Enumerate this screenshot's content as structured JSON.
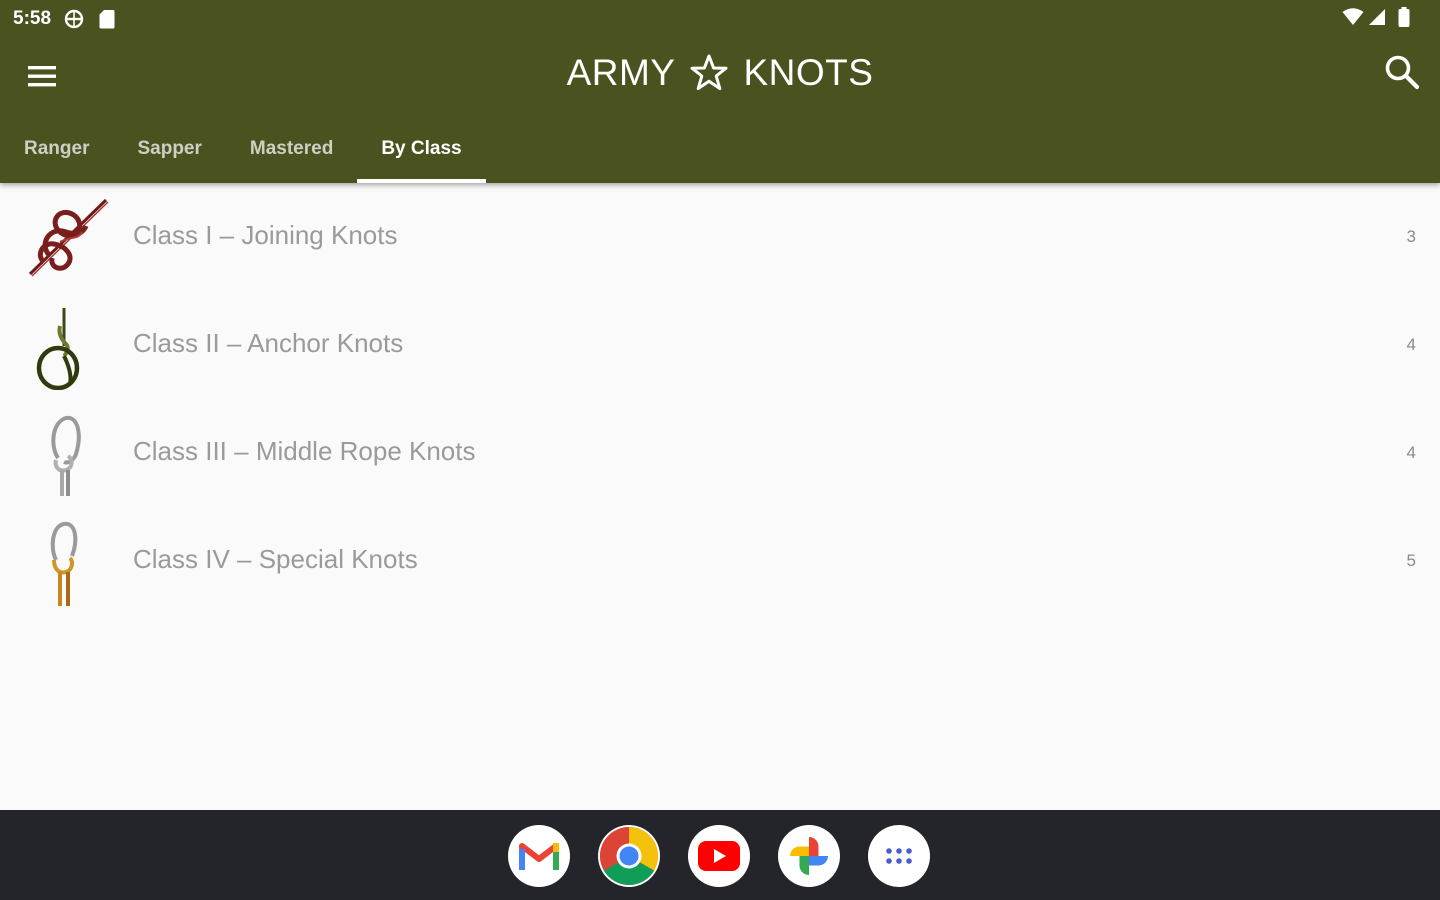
{
  "status_bar": {
    "time": "5:58",
    "icons": [
      "vpn-globe-icon",
      "sd-card-icon",
      "wifi-icon",
      "cell-signal-icon",
      "battery-icon"
    ]
  },
  "toolbar": {
    "title_left": "ARMY",
    "title_right": "KNOTS",
    "title_icon": "star-outline-icon",
    "menu_icon": "hamburger-menu-icon",
    "search_icon": "search-icon"
  },
  "tabs": [
    {
      "label": "Ranger",
      "active": false
    },
    {
      "label": "Sapper",
      "active": false
    },
    {
      "label": "Mastered",
      "active": false
    },
    {
      "label": "By Class",
      "active": true
    }
  ],
  "classes": [
    {
      "label": "Class I – Joining Knots",
      "count": "3",
      "icon": "figure-eight-knot-icon",
      "color": "#7a1d1d"
    },
    {
      "label": "Class II – Anchor Knots",
      "count": "4",
      "icon": "noose-knot-icon",
      "color": "#3b4a12"
    },
    {
      "label": "Class III – Middle Rope Knots",
      "count": "4",
      "icon": "carabiner-gray-knot-icon",
      "color": "#8a8a8a"
    },
    {
      "label": "Class IV – Special Knots",
      "count": "5",
      "icon": "carabiner-orange-knot-icon",
      "color": "#c8861f"
    }
  ],
  "dock": {
    "apps": [
      "gmail-icon",
      "chrome-icon",
      "youtube-icon",
      "photos-icon",
      "app-drawer-icon"
    ]
  },
  "colors": {
    "header": "#4a5320",
    "background": "#fafafa",
    "dock": "#24252b"
  }
}
